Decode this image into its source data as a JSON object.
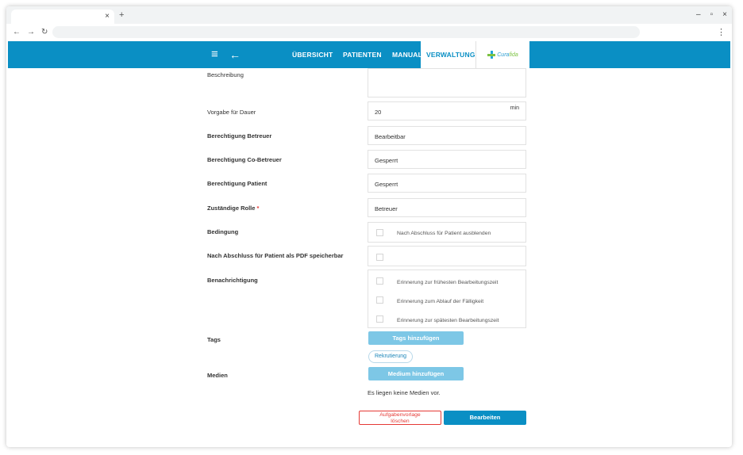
{
  "browser": {
    "tab_close": "×",
    "new_tab": "+",
    "minimize": "–",
    "restore": "▫",
    "close": "×",
    "back": "←",
    "forward": "→",
    "reload": "↻",
    "menu": "⋮"
  },
  "header": {
    "menu_icon": "≡",
    "back_icon": "←",
    "nav": [
      {
        "label": "ÜBERSICHT",
        "active": false
      },
      {
        "label": "PATIENTEN",
        "active": false
      },
      {
        "label": "MANUAL",
        "active": false
      },
      {
        "label": "VERWALTUNG",
        "active": true
      }
    ],
    "logo": {
      "part1": "Cura",
      "part2": "fida"
    }
  },
  "form": {
    "beschreibung": {
      "label": "Beschreibung",
      "value": ""
    },
    "dauer": {
      "label": "Vorgabe für Dauer",
      "value": "20",
      "unit": "min"
    },
    "berechtigung_betreuer": {
      "label": "Berechtigung Betreuer",
      "value": "Bearbeitbar"
    },
    "berechtigung_cobetreuer": {
      "label": "Berechtigung Co-Betreuer",
      "value": "Gesperrt"
    },
    "berechtigung_patient": {
      "label": "Berechtigung Patient",
      "value": "Gesperrt"
    },
    "rolle": {
      "label": "Zuständige Rolle",
      "required_mark": "*",
      "value": "Betreuer"
    },
    "bedingung": {
      "label": "Bedingung",
      "option": "Nach Abschluss für Patient ausblenden",
      "checked": false
    },
    "pdf": {
      "label": "Nach Abschluss für Patient als PDF speicherbar",
      "checked": false
    },
    "benachrichtigung": {
      "label": "Benachrichtigung",
      "options": [
        {
          "label": "Erinnerung zur frühesten Bearbeitungszeit",
          "checked": false
        },
        {
          "label": "Erinnerung zum Ablauf der Fälligkeit",
          "checked": false
        },
        {
          "label": "Erinnerung zur spätesten Bearbeitungszeit",
          "checked": false
        }
      ]
    },
    "tags": {
      "label": "Tags",
      "button": "Tags hinzufügen",
      "items": [
        "Rekrutierung"
      ]
    },
    "medien": {
      "label": "Medien",
      "button": "Medium hinzufügen",
      "empty_text": "Es liegen keine Medien vor."
    }
  },
  "actions": {
    "delete_line1": "Aufgabenvorlage",
    "delete_line2": "löschen",
    "edit": "Bearbeiten"
  },
  "colors": {
    "primary": "#0a8fc4",
    "button_light": "#7dc7e6",
    "danger": "#e53935"
  }
}
